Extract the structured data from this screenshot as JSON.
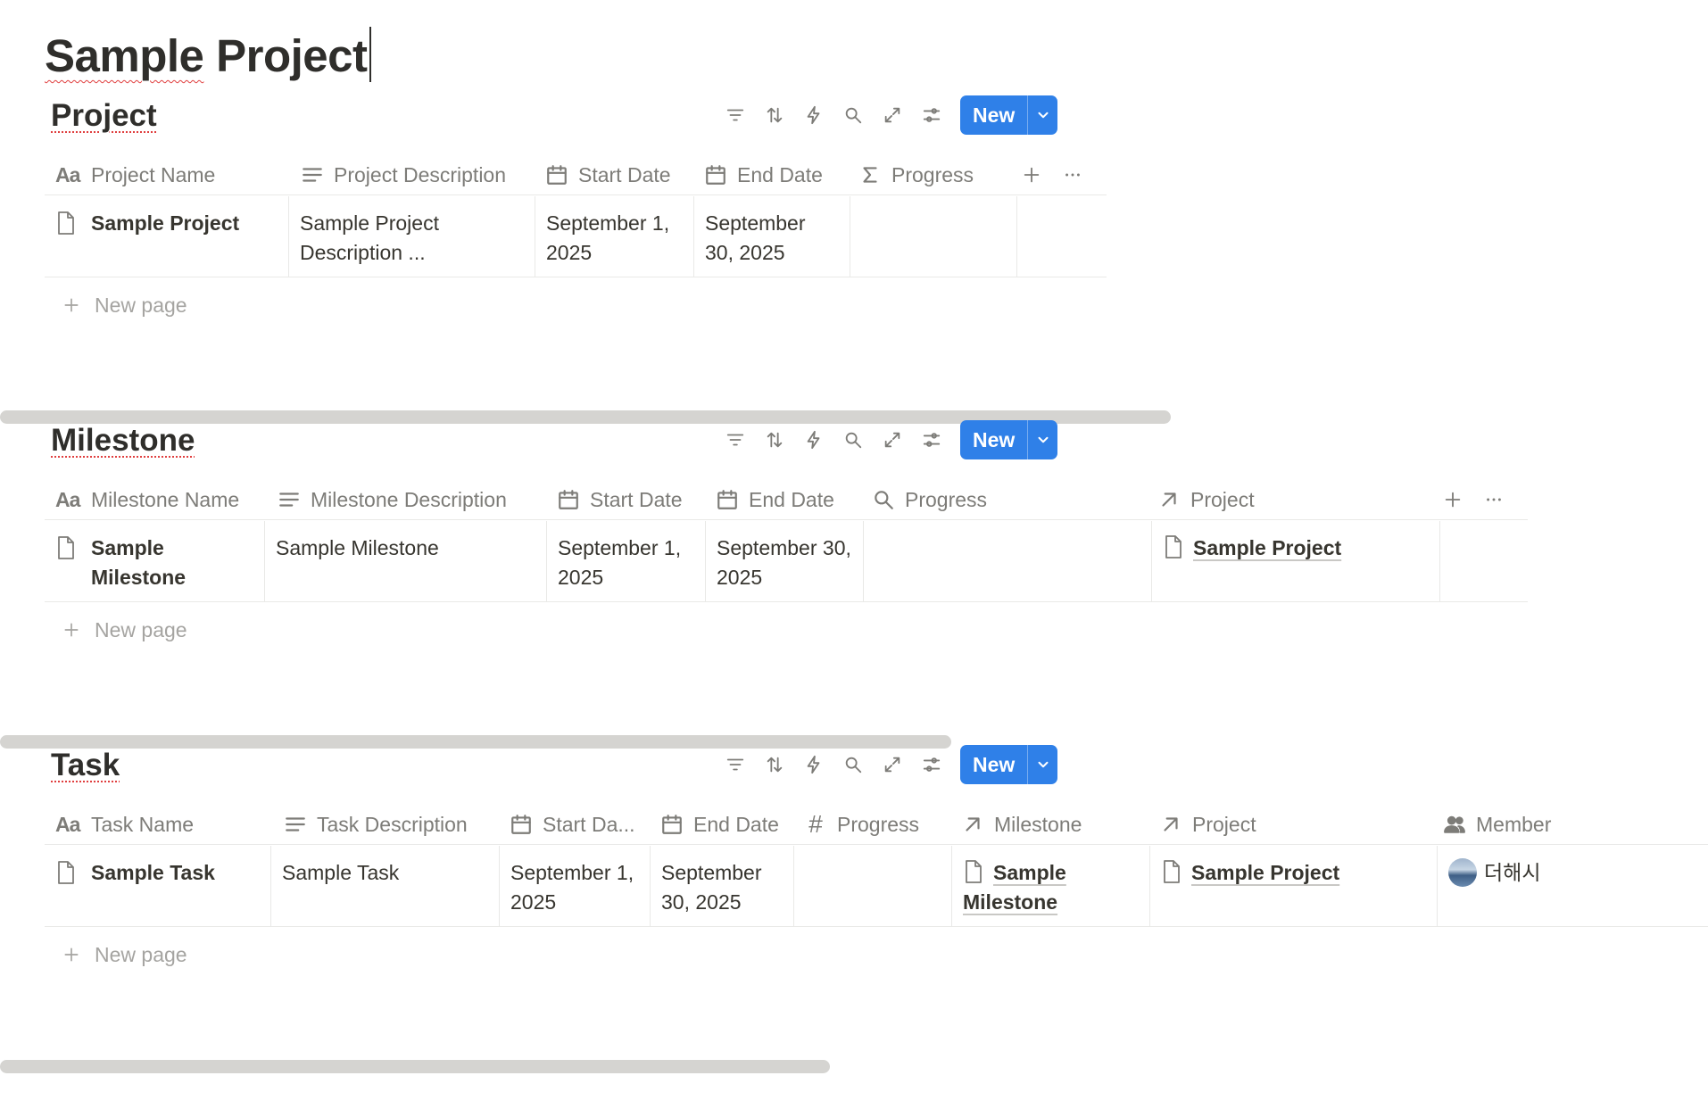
{
  "page": {
    "title_part1": "Sample",
    "title_part2": " Project"
  },
  "toolbar": {
    "icons": [
      "filter-icon",
      "sort-icon",
      "automation-icon",
      "search-icon",
      "expand-icon",
      "settings-icon"
    ],
    "new_label": "New"
  },
  "databases": {
    "project": {
      "title": "Project",
      "headers": {
        "name": "Project Name",
        "description": "Project Description",
        "start": "Start Date",
        "end": "End Date",
        "progress": "Progress"
      },
      "row": {
        "name": "Sample Project",
        "description": "Sample Project Description ...",
        "start": "September 1, 2025",
        "end": "September 30, 2025",
        "progress": ""
      },
      "new_page": "New page"
    },
    "milestone": {
      "title": "Milestone",
      "headers": {
        "name": "Milestone Name",
        "description": "Milestone Description",
        "start": "Start Date",
        "end": "End Date",
        "progress": "Progress",
        "project": "Project"
      },
      "row": {
        "name": "Sample Milestone",
        "description": "Sample Milestone",
        "start": "September 1, 2025",
        "end": "September 30, 2025",
        "progress": "",
        "project": "Sample Project"
      },
      "new_page": "New page"
    },
    "task": {
      "title": "Task",
      "headers": {
        "name": "Task Name",
        "description": "Task Description",
        "start": "Start Da...",
        "end": "End Date",
        "progress": "Progress",
        "milestone": "Milestone",
        "project": "Project",
        "member": "Member"
      },
      "row": {
        "name": "Sample Task",
        "description": "Sample Task",
        "start": "September 1, 2025",
        "end": "September 30, 2025",
        "progress": "",
        "milestone": "Sample Milestone",
        "project": "Sample Project",
        "member": "더해시"
      },
      "new_page": "New page"
    }
  },
  "colors": {
    "accent": "#2f80e8",
    "text": "#37352f",
    "muted": "#7d7c78",
    "border": "#e9e9e7",
    "scrollbar": "#d5d4d1"
  }
}
